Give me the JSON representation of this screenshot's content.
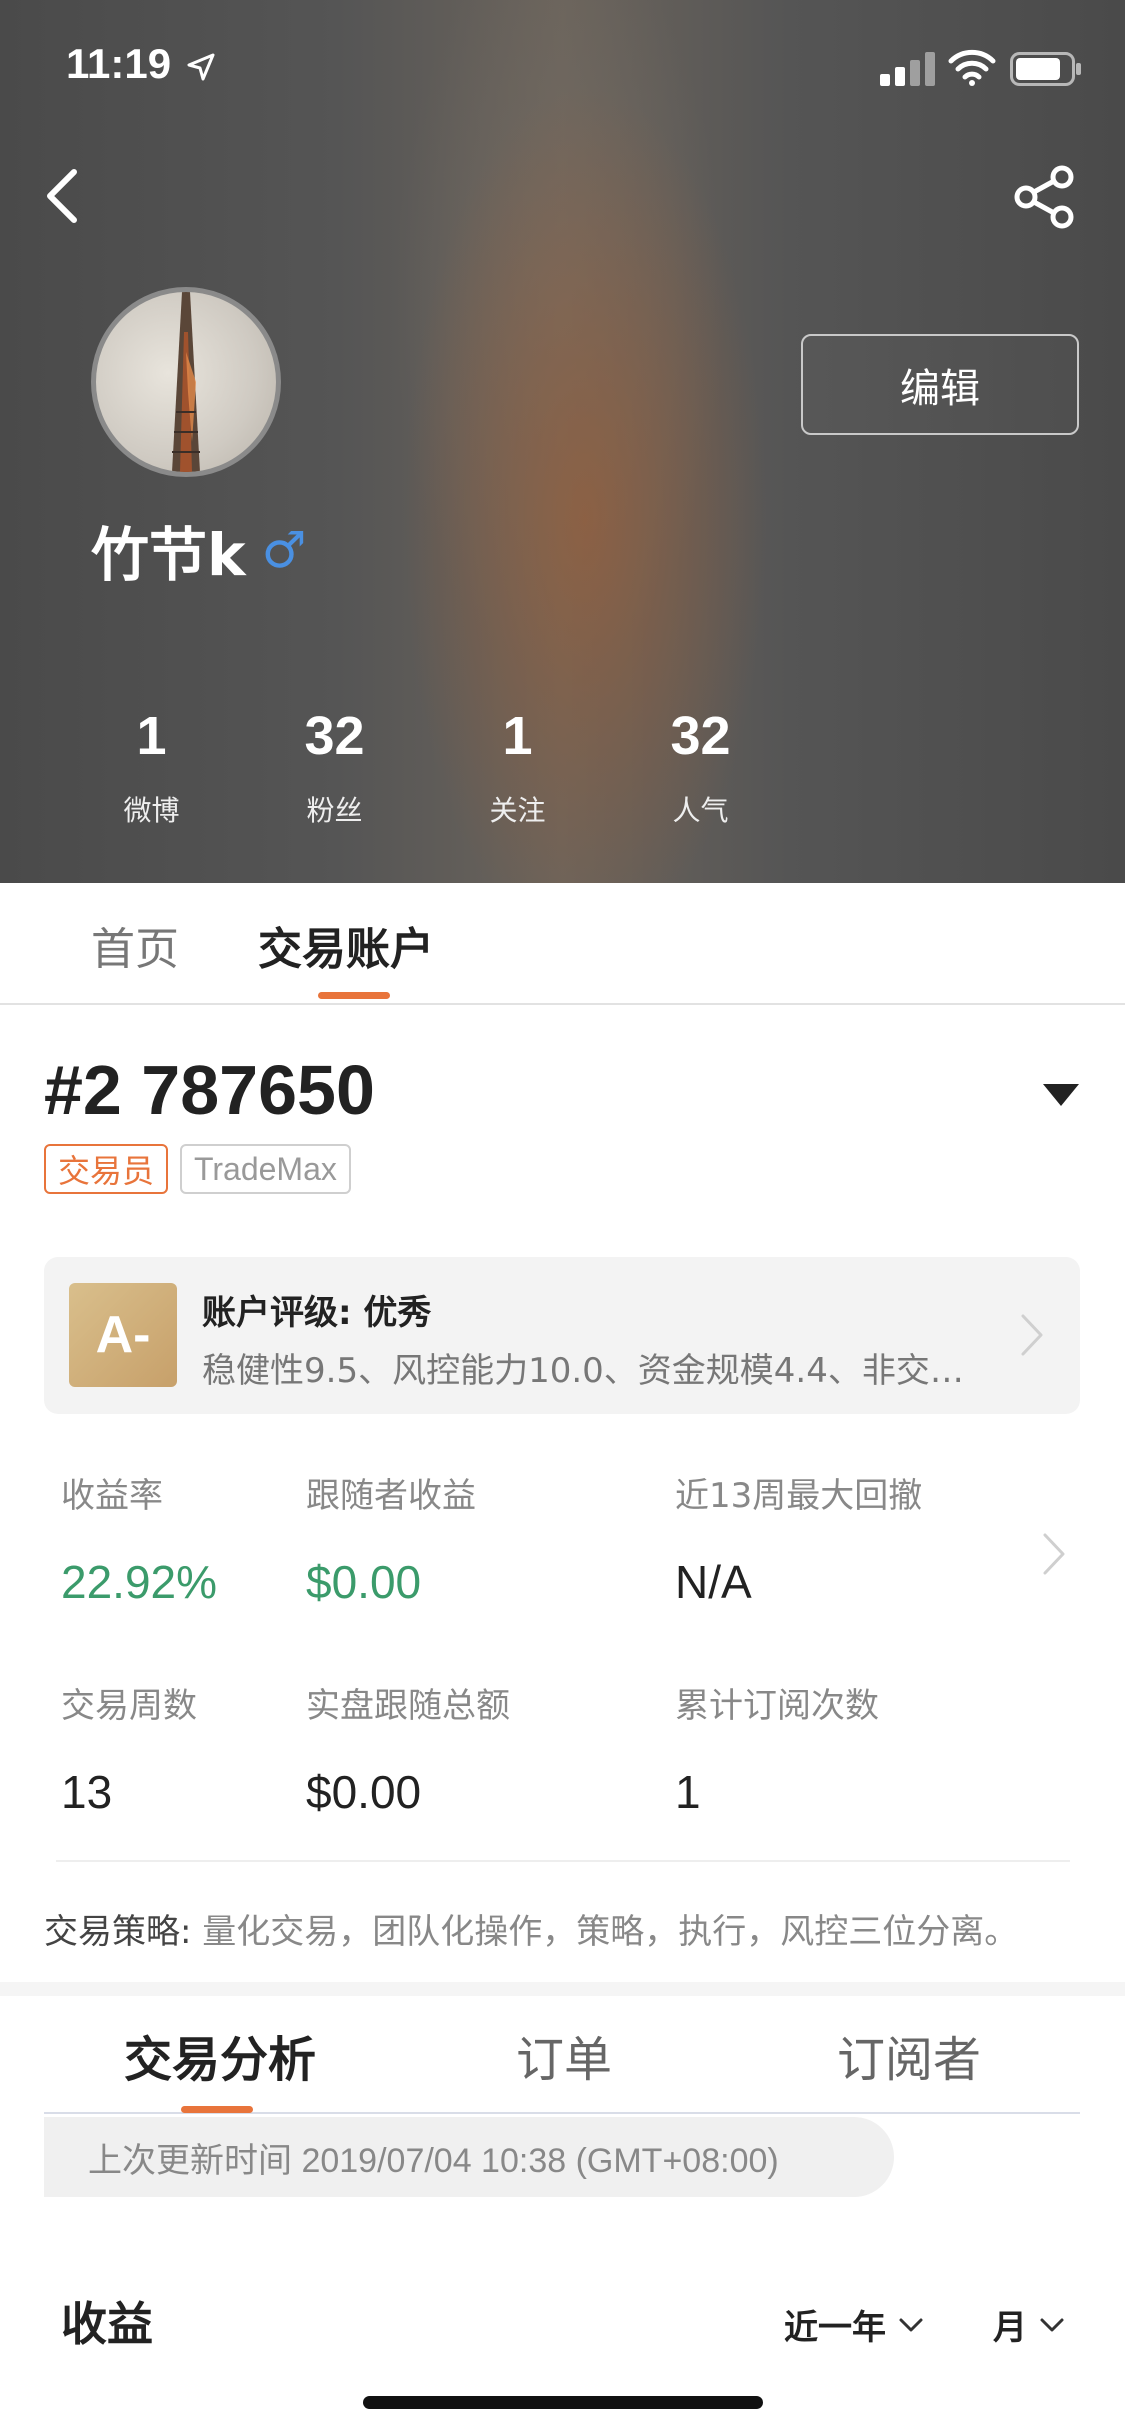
{
  "status_bar": {
    "time": "11:19"
  },
  "profile": {
    "edit_label": "编辑",
    "username": "竹节k",
    "gender_symbol": "♂",
    "stats": [
      {
        "value": "1",
        "label": "微博"
      },
      {
        "value": "32",
        "label": "粉丝"
      },
      {
        "value": "1",
        "label": "关注"
      },
      {
        "value": "32",
        "label": "人气"
      }
    ]
  },
  "profile_tabs": [
    {
      "label": "首页",
      "active": false
    },
    {
      "label": "交易账户",
      "active": true
    }
  ],
  "account": {
    "id": "#2 787650",
    "badges": {
      "role": "交易员",
      "platform": "TradeMax"
    },
    "rating": {
      "grade": "A-",
      "title": "账户评级: 优秀",
      "description": "稳健性9.5、风控能力10.0、资金规模4.4、非交易..."
    },
    "metrics": [
      {
        "label": "收益率",
        "value": "22.92%",
        "highlight": true
      },
      {
        "label": "跟随者收益",
        "value": "$0.00",
        "highlight": true
      },
      {
        "label": "近13周最大回撤",
        "value": "N/A",
        "highlight": false
      },
      {
        "label": "交易周数",
        "value": "13",
        "highlight": false
      },
      {
        "label": "实盘跟随总额",
        "value": "$0.00",
        "highlight": false
      },
      {
        "label": "累计订阅次数",
        "value": "1",
        "highlight": false
      }
    ],
    "strategy_key": "交易策略:",
    "strategy_value": " 量化交易，团队化操作，策略，执行，风控三位分离。"
  },
  "analysis_tabs": [
    {
      "label": "交易分析",
      "active": true
    },
    {
      "label": "订单",
      "active": false
    },
    {
      "label": "订阅者",
      "active": false
    }
  ],
  "update_time": "上次更新时间 2019/07/04 10:38 (GMT+08:00)",
  "income": {
    "title": "收益",
    "range_filter": "近一年",
    "period_filter": "月"
  },
  "colors": {
    "accent": "#e8743b",
    "positive": "#3b9b6b",
    "gender_male": "#4a90e2",
    "grade_gold": "#c7a06a"
  }
}
